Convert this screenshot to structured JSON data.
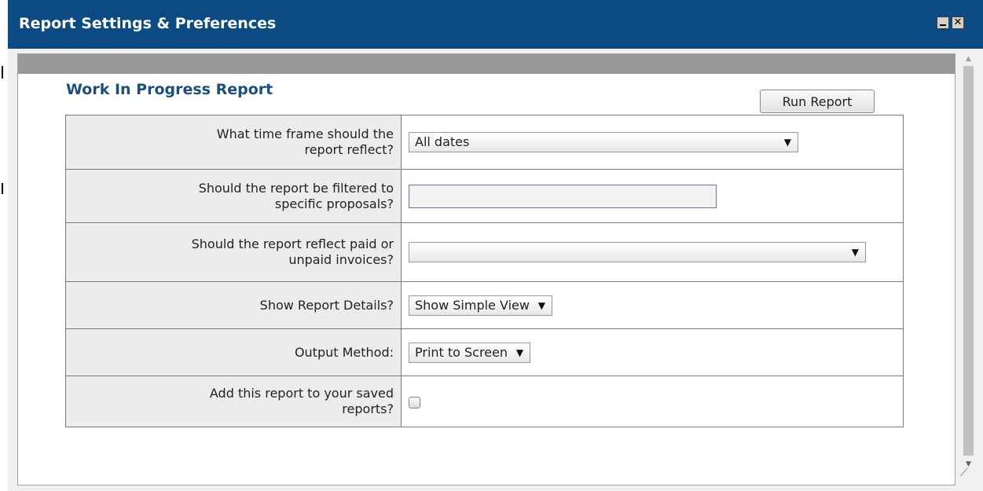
{
  "window": {
    "title": "Report Settings & Preferences",
    "close_glyph": "✕"
  },
  "report": {
    "title": "Work In Progress Report",
    "run_label": "Run Report"
  },
  "settings": {
    "timeframe": {
      "question": "What time frame should the report reflect?",
      "value": "All dates"
    },
    "proposals": {
      "question": "Should the report be filtered to specific proposals?",
      "value": ""
    },
    "invoices": {
      "question": "Should the report reflect paid or unpaid invoices?",
      "value": ""
    },
    "details": {
      "question": "Show Report Details?",
      "value": "Show Simple View"
    },
    "output": {
      "question": "Output Method:",
      "value": "Print to Screen"
    },
    "saved": {
      "question": "Add this report to your saved reports?",
      "checked": false
    }
  },
  "icons": {
    "dropdown_arrow": "▼",
    "scroll_up": "▲",
    "scroll_down": "▼"
  }
}
